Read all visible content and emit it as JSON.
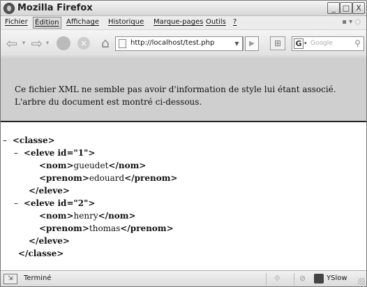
{
  "window": {
    "title": "Mozilla Firefox",
    "controls": {
      "minimize": "_",
      "maximize": "□",
      "close": "X"
    }
  },
  "menu": {
    "items": [
      {
        "label": "Fichier"
      },
      {
        "label": "Édition"
      },
      {
        "label": "Affichage"
      },
      {
        "label": "Historique"
      },
      {
        "label": "Marque-pages"
      },
      {
        "label": "Outils"
      },
      {
        "label": "?"
      }
    ],
    "right_icons": "▪ ▾ ◌"
  },
  "navbar": {
    "back_icon": "⇦",
    "forward_icon": "⇨",
    "drop_icon": "▾",
    "reload_icon": "reload-icon",
    "stop_icon": "×",
    "home_icon": "⌂",
    "url": "http://localhost/test.php",
    "url_drop": "▼",
    "go_icon": "▶",
    "addon_icon": "⊞",
    "search_engine_letter": "G",
    "search_engine_drop": "▾",
    "search_placeholder": "Google",
    "search_icon": "⚲"
  },
  "content": {
    "info_message": "Ce fichier XML ne semble pas avoir d'information de style lui étant associé. L'arbre du document est montré ci-dessous.",
    "xml_lines": [
      {
        "toggle": "–",
        "open": "<classe>",
        "text": "",
        "close": ""
      },
      {
        "toggle": "–",
        "open": "<eleve id=\"1\">",
        "text": "",
        "close": ""
      },
      {
        "toggle": "",
        "open": "<nom>",
        "text": "gueudet",
        "close": "</nom>"
      },
      {
        "toggle": "",
        "open": "<prenom>",
        "text": "edouard",
        "close": "</prenom>"
      },
      {
        "toggle": "",
        "open": "</eleve>",
        "text": "",
        "close": ""
      },
      {
        "toggle": "–",
        "open": "<eleve id=\"2\">",
        "text": "",
        "close": ""
      },
      {
        "toggle": "",
        "open": "<nom>",
        "text": "henry",
        "close": "</nom>"
      },
      {
        "toggle": "",
        "open": "<prenom>",
        "text": "thomas",
        "close": "</prenom>"
      },
      {
        "toggle": "",
        "open": "</eleve>",
        "text": "",
        "close": ""
      },
      {
        "toggle": "",
        "open": "</classe>",
        "text": "",
        "close": ""
      }
    ]
  },
  "statusbar": {
    "status_text": "Terminé",
    "yslow_label": "YSlow",
    "indicator_1": "⟐",
    "indicator_2": "⊘"
  }
}
